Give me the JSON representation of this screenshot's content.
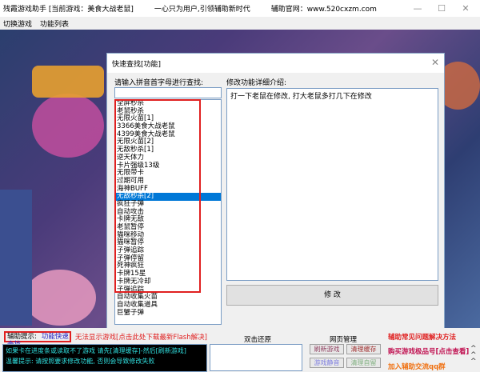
{
  "window": {
    "title": "残霞游戏助手 [当前游戏：美食大战老鼠]",
    "slogan": "一心只为用户,引领辅助新时代",
    "site": "辅助官网：www.520cxzm.com",
    "minimize": "—",
    "maximize": "☐",
    "close": "✕"
  },
  "menu": [
    "切换游戏",
    "功能列表"
  ],
  "dialog": {
    "title": "快速查找[功能]",
    "close": "✕",
    "search_label": "请输入拼音首字母进行查找:",
    "search_value": "",
    "desc_label": "修改功能详细介绍:",
    "desc_text": "打一下老鼠在修改, 打大老鼠多打几下在修改",
    "modify_button": "修 改",
    "selected_index": 13,
    "items": [
      "全屏秒杀",
      "老鼠秒杀",
      "无限火苗[1]",
      "3366美食大战老鼠",
      "4399美食大战老鼠",
      "无限火苗[2]",
      "无敌秒杀[1]",
      "逆天体力",
      "卡片强级13级",
      "无限带卡",
      "过期可用",
      "海神BUFF",
      "无敌秒杀[2]",
      "疯狂子弹",
      "自动攻击",
      "卡牌无敌",
      "老鼠暂停",
      "猫咪移动",
      "猫咪暂停",
      "子弹追踪",
      "子弹停留",
      "死神疯狂",
      "卡牌15星",
      "卡牌无冷却",
      "子弹追踪",
      "自动收集火苗",
      "自动收集道具",
      "巨蟹子弹"
    ]
  },
  "bottom": {
    "hint_label": "辅助提示:",
    "hint_link": "功能快速查找",
    "flash_notice": "无法显示游戏[点击此处下载最新Flash解决]",
    "console": [
      "如果卡在进度条或读取不了游戏 请先[清理缓存]-然后[刷新游戏]",
      "温馨提示: 请按照要求修改功能, 否则会导致修改失败"
    ],
    "dblclick_label": "双击还原",
    "web_label": "网页管理",
    "web_buttons": [
      "刷新游戏",
      "清理缓存",
      "游戏静音",
      "清理自留"
    ],
    "links": [
      "辅助常见问题解决方法",
      "购买游戏极品号[点击查看]",
      "加入辅助交流qq群"
    ],
    "arrows": "^^^"
  }
}
